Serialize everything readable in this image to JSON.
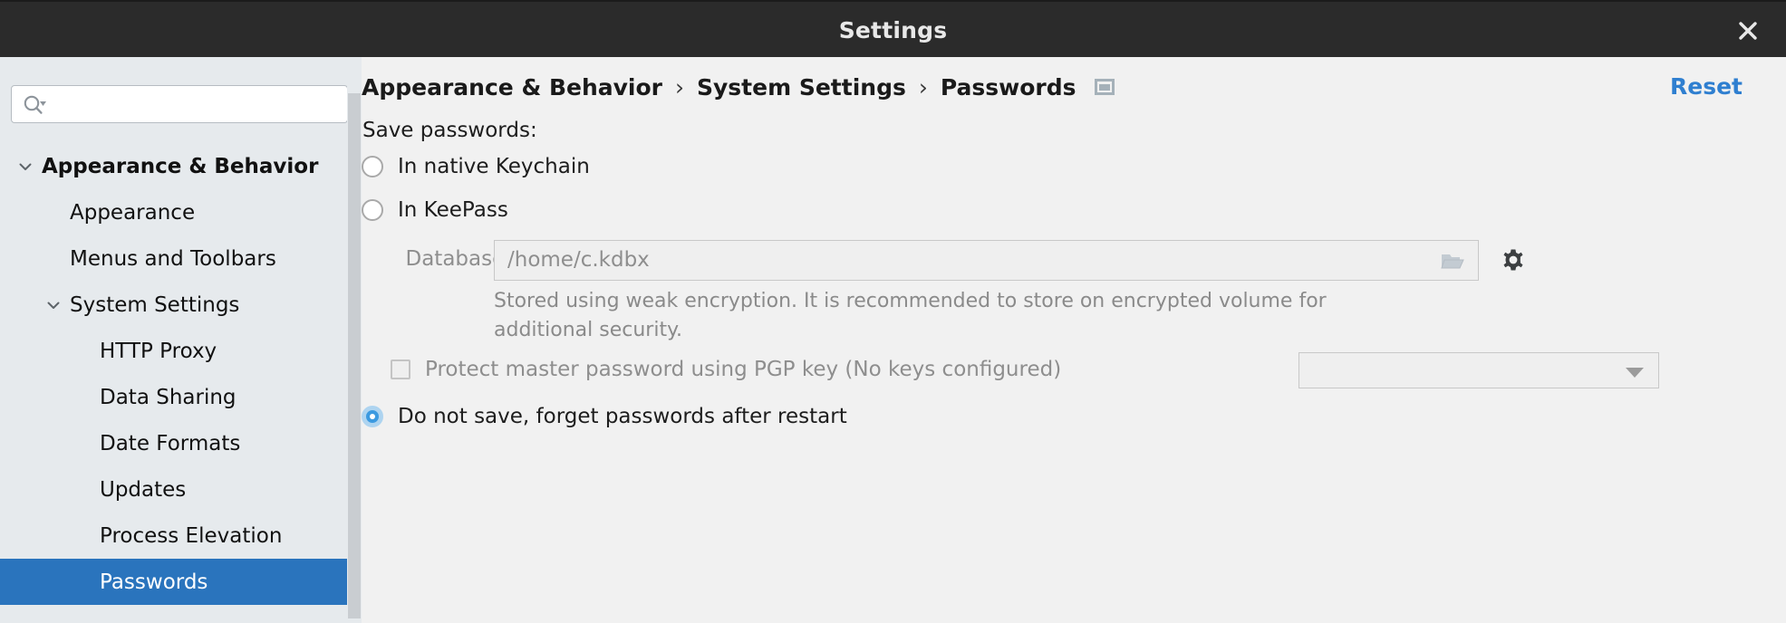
{
  "window": {
    "title": "Settings",
    "close_icon": "close-icon"
  },
  "sidebar": {
    "search": {
      "value": "",
      "placeholder": "",
      "icon": "search-icon"
    },
    "items": [
      {
        "label": "Appearance & Behavior",
        "level": 0,
        "bold": true,
        "twisty": "chevron-down-icon",
        "selected": false
      },
      {
        "label": "Appearance",
        "level": 1,
        "bold": false,
        "twisty": "",
        "selected": false
      },
      {
        "label": "Menus and Toolbars",
        "level": 1,
        "bold": false,
        "twisty": "",
        "selected": false
      },
      {
        "label": "System Settings",
        "level": 1,
        "bold": false,
        "twisty": "chevron-down-icon",
        "selected": false
      },
      {
        "label": "HTTP Proxy",
        "level": 2,
        "bold": false,
        "twisty": "",
        "selected": false
      },
      {
        "label": "Data Sharing",
        "level": 2,
        "bold": false,
        "twisty": "",
        "selected": false
      },
      {
        "label": "Date Formats",
        "level": 2,
        "bold": false,
        "twisty": "",
        "selected": false
      },
      {
        "label": "Updates",
        "level": 2,
        "bold": false,
        "twisty": "",
        "selected": false
      },
      {
        "label": "Process Elevation",
        "level": 2,
        "bold": false,
        "twisty": "",
        "selected": false
      },
      {
        "label": "Passwords",
        "level": 2,
        "bold": false,
        "twisty": "",
        "selected": true
      }
    ],
    "selected_color": "#2a74bd",
    "background_color": "#e6eaed"
  },
  "content": {
    "breadcrumb": {
      "crumbs": [
        "Appearance & Behavior",
        "System Settings",
        "Passwords"
      ],
      "separator": "›",
      "trailing_icon": "window-icon"
    },
    "reset_label": "Reset",
    "reset_color": "#2f7fd0",
    "save_passwords_label": "Save passwords:",
    "options": [
      {
        "label": "In native Keychain",
        "checked": false
      },
      {
        "label": "In KeePass",
        "checked": false
      },
      {
        "label": "Do not save, forget passwords after restart",
        "checked": true
      }
    ],
    "database": {
      "label": "Database:",
      "value": "/home/c.kdbx",
      "placeholder": "",
      "browse_icon": "folder-icon",
      "settings_icon": "gear-icon",
      "enabled": false
    },
    "encryption_note": "Stored using weak encryption. It is recommended to store on encrypted volume for additional security.",
    "pgp": {
      "label": "Protect master password using PGP key (No keys configured)",
      "checked": false,
      "enabled": false,
      "select_value": "",
      "select_options": []
    }
  }
}
